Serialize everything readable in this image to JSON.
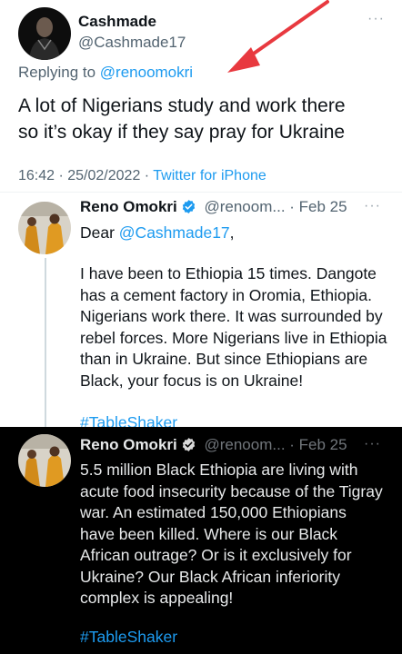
{
  "main_tweet": {
    "display_name": "Cashmade",
    "handle": "@Cashmade17",
    "replying_to_prefix": "Replying to ",
    "replying_to_handle": "@renoomokri",
    "text_line1": "A lot of Nigerians study and work there",
    "text_line2": "so it’s okay if they say pray for Ukraine",
    "timestamp": "16:42 · 25/02/2022 · ",
    "source": "Twitter for iPhone",
    "more_icon": "ellipsis-icon"
  },
  "reply1": {
    "display_name": "Reno Omokri",
    "handle_date": "@renoom... · Feb 25",
    "salutation_prefix": "Dear ",
    "salutation_mention": "@Cashmade17",
    "salutation_suffix": ",",
    "lines": [
      "I have been to Ethiopia 15 times. Dangote",
      "has a cement factory in Oromia, Ethiopia.",
      "Nigerians work there. It was surrounded by",
      "rebel forces. More Nigerians live in Ethiopia",
      "than in Ukraine. But since Ethiopians are",
      "Black, your focus is on Ukraine!"
    ],
    "hashtag": "#TableShaker",
    "more_icon": "ellipsis-icon"
  },
  "reply2": {
    "display_name": "Reno Omokri",
    "handle_date": "@renoom... · Feb 25",
    "lines": [
      "5.5 million Black Ethiopia are living with",
      "acute food insecurity because of the Tigray",
      "war. An estimated 150,000 Ethiopians",
      "have been killed. Where is our Black",
      "African outrage? Or is it exclusively for",
      "Ukraine? Our Black African inferiority",
      "complex is appealing!"
    ],
    "hashtag": "#TableShaker",
    "more_icon": "ellipsis-icon"
  },
  "colors": {
    "link": "#1d9bf0",
    "arrow": "#e8393f",
    "verified": "#1d9bf0"
  }
}
